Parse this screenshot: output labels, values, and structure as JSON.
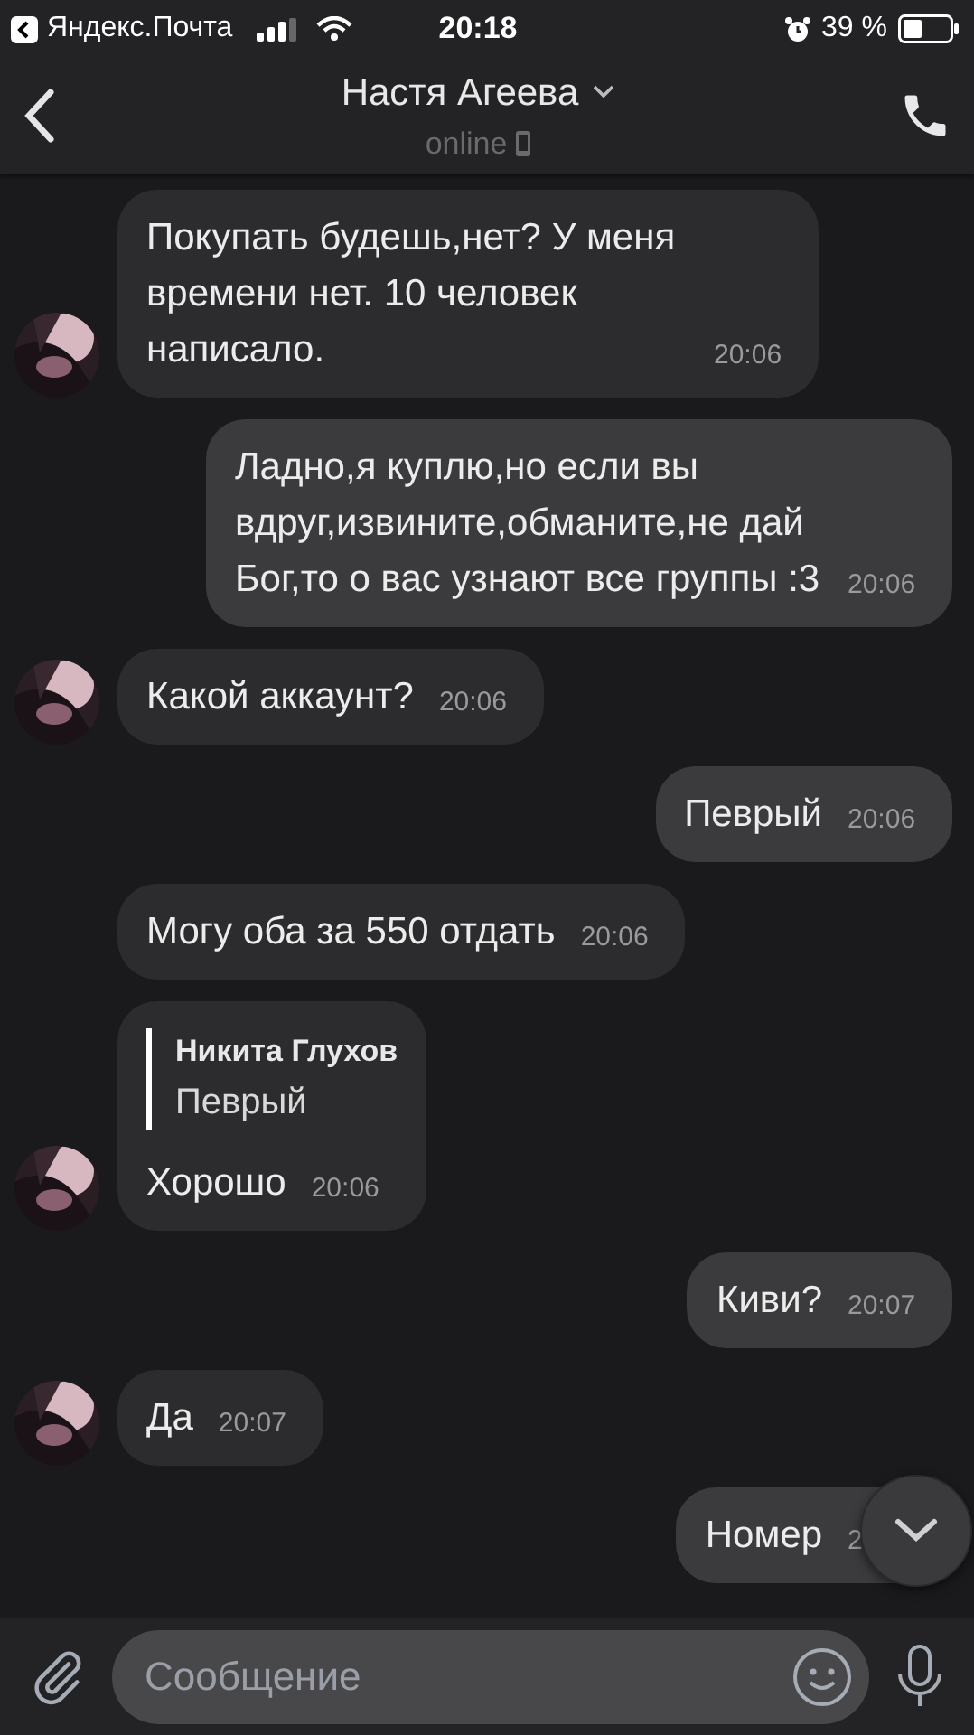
{
  "status_bar": {
    "back_app": "Яндекс.Почта",
    "time": "20:18",
    "battery": "39 %"
  },
  "header": {
    "name": "Настя Агеева",
    "status": "online"
  },
  "messages": [
    {
      "kind": "incoming",
      "avatar": true,
      "text": "Покупать будешь,нет? У меня времени нет. 10 человек написало.",
      "time": "20:06"
    },
    {
      "kind": "outgoing",
      "text": "Ладно,я куплю,но если вы вдруг,извините,обманите,не дай Бог,то о вас узнают все группы :3",
      "time": "20:06"
    },
    {
      "kind": "incoming",
      "avatar": true,
      "text": "Какой аккаунт?",
      "time": "20:06"
    },
    {
      "kind": "outgoing",
      "text": "Певрый",
      "time": "20:06"
    },
    {
      "kind": "incoming",
      "avatar": false,
      "text": "Могу оба за 550 отдать",
      "time": "20:06"
    },
    {
      "kind": "incoming",
      "avatar": true,
      "reply": {
        "author": "Никита Глухов",
        "text": "Певрый"
      },
      "text": "Хорошо",
      "time": "20:06"
    },
    {
      "kind": "outgoing",
      "text": "Киви?",
      "time": "20:07"
    },
    {
      "kind": "incoming",
      "avatar": true,
      "text": "Да",
      "time": "20:07"
    },
    {
      "kind": "outgoing",
      "text": "Номер",
      "time": "2"
    }
  ],
  "composer": {
    "placeholder": "Сообщение"
  }
}
